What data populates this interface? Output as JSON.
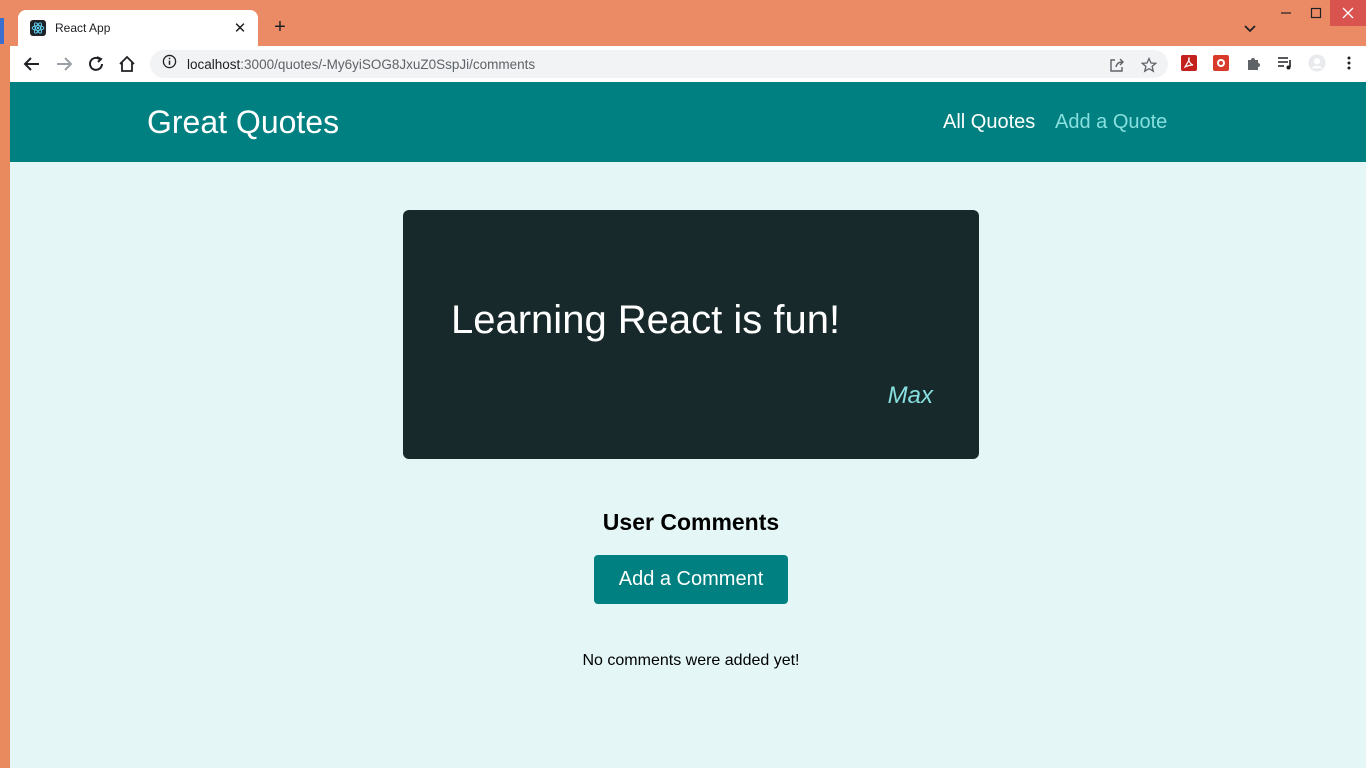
{
  "browser": {
    "tab_title": "React App",
    "url_host": "localhost",
    "url_path": ":3000/quotes/-My6yiSOG8JxuZ0SspJi/comments"
  },
  "header": {
    "logo": "Great Quotes",
    "nav": [
      {
        "label": "All Quotes"
      },
      {
        "label": "Add a Quote"
      }
    ]
  },
  "quote": {
    "text": "Learning React is fun!",
    "author": "Max"
  },
  "comments": {
    "title": "User Comments",
    "add_button": "Add a Comment",
    "empty_message": "No comments were added yet!"
  },
  "colors": {
    "header_bg": "#008080",
    "page_bg": "#e4f6f6",
    "card_bg": "#18292b",
    "accent": "#88dfdf"
  }
}
